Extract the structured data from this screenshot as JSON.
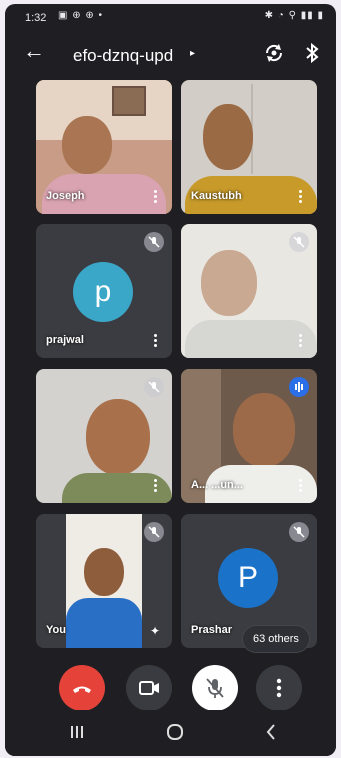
{
  "status_bar": {
    "time": "1:32"
  },
  "header": {
    "meeting_code": "efo-dznq-upd"
  },
  "participants": [
    {
      "name": "Joseph"
    },
    {
      "name": "Kaustubh"
    },
    {
      "name": "prajwal",
      "initial": "p",
      "avatar_color": "#3aa7c9"
    },
    {
      "name": ""
    },
    {
      "name": ""
    },
    {
      "name": "A... ...un..."
    },
    {
      "name": "You"
    },
    {
      "name": "Prashar",
      "initial": "P",
      "avatar_color": "#1a73c8"
    }
  ],
  "others_badge": "63 others",
  "controls": {
    "end_call_color": "#e5433a",
    "mic_button_color": "#ffffff",
    "button_color": "#3a3b40"
  },
  "icons": [
    "back-arrow-icon",
    "switch-camera-icon",
    "bluetooth-icon",
    "mic-off-icon",
    "mic-on-icon",
    "more-vert-icon",
    "end-call-icon",
    "camera-icon",
    "mic-muted-icon",
    "recents-icon",
    "home-icon",
    "back-icon"
  ]
}
